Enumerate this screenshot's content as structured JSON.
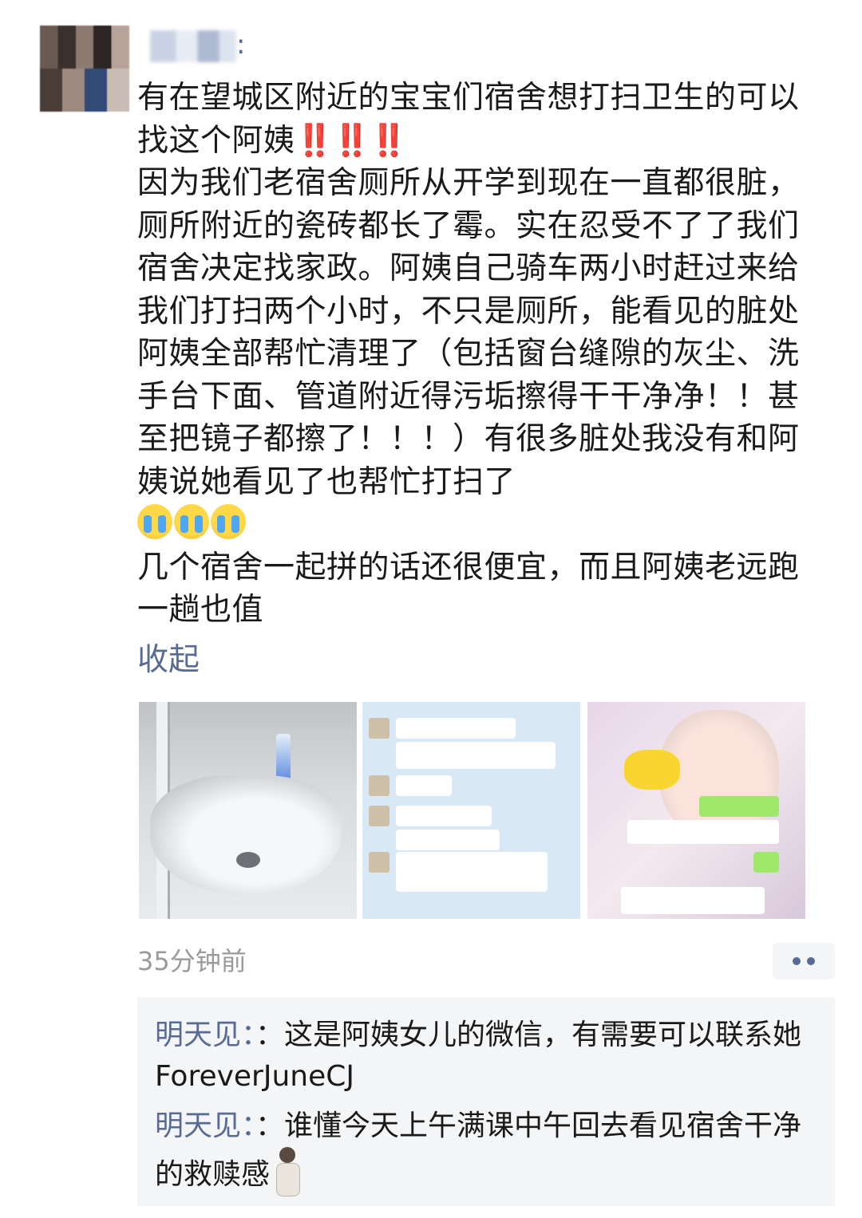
{
  "post": {
    "author_suffix": ":",
    "paragraphs": {
      "p1": "有在望城区附近的宝宝们宿舍想打扫卫生的可以找这个阿姨",
      "p1_bangs": "‼️‼️‼️",
      "p2": "因为我们老宿舍厕所从开学到现在一直都很脏，厕所附近的瓷砖都长了霉。实在忍受不了了我们宿舍决定找家政。阿姨自己骑车两小时赶过来给我们打扫两个小时，不只是厕所，能看见的脏处阿姨全部帮忙清理了（包括窗台缝隙的灰尘、洗手台下面、管道附近得污垢擦得干干净净！！甚至把镜子都擦了！！！）有很多脏处我没有和阿姨说她看见了也帮忙打扫了",
      "p3": "几个宿舍一起拼的话还很便宜，而且阿姨老远跑一趟也值"
    },
    "emoji_icons": [
      "crying-face-icon",
      "crying-face-icon",
      "crying-face-icon"
    ],
    "collapse_label": "收起",
    "timestamp": "35分钟前"
  },
  "comments": [
    {
      "author": "明天见：",
      "text": "：这是阿姨女儿的微信，有需要可以联系她ForeverJuneCJ"
    },
    {
      "author": "明天见：",
      "text": "：谁懂今天上午满课中午回去看见宿舍干净的救赎感"
    }
  ],
  "colors": {
    "link": "#576b95",
    "text": "#1a1a1a",
    "meta": "#9a9a9a",
    "comment_bg": "#f4f5f7"
  }
}
